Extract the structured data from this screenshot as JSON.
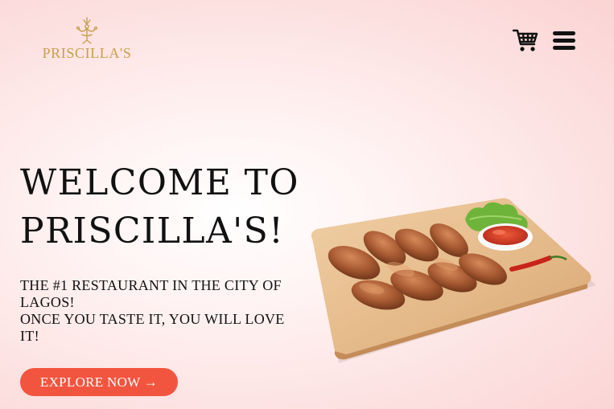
{
  "header": {
    "logo_text": "PRISCILLA'S",
    "cart_icon": "shopping-cart-icon",
    "menu_icon": "hamburger-menu-icon"
  },
  "hero": {
    "title_line1": "WELCOME TO",
    "title_line2": "PRISCILLA'S!",
    "tagline_line1": "THE #1 RESTAURANT IN THE CITY OF",
    "tagline_line2": "LAGOS!",
    "tagline_line3": "ONCE YOU TASTE IT, YOU WILL LOVE",
    "tagline_line4": "IT!",
    "cta_label": "EXPLORE NOW",
    "cta_arrow": "→",
    "image_icon": "chicken-wings-platter-image"
  },
  "colors": {
    "accent": "#f2553f",
    "brand_gold": "#c9a04a",
    "text": "#111111",
    "background": "#fde4e4"
  }
}
